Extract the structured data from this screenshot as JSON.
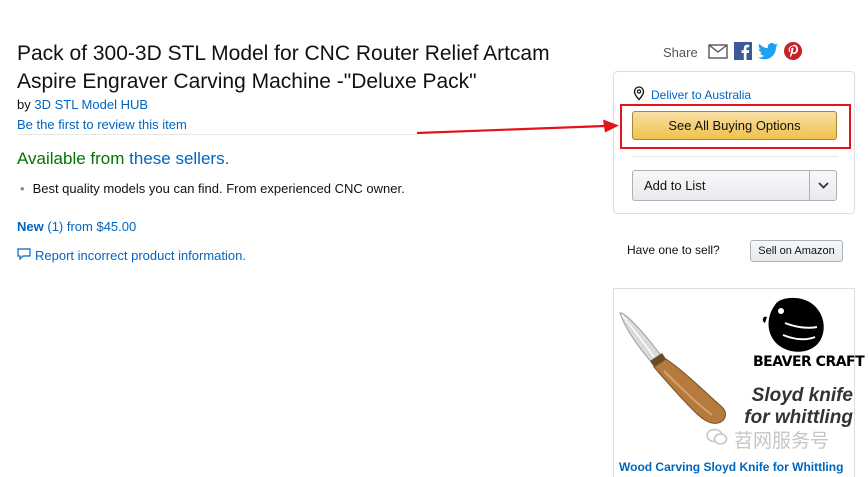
{
  "product": {
    "title": "Pack of 300-3D STL Model for CNC Router Relief Artcam Aspire Engraver Carving Machine -\"Deluxe Pack\"",
    "by_prefix": "by",
    "brand": "3D STL Model HUB",
    "review_link": "Be the first to review this item",
    "available_prefix": "Available from",
    "available_link": "these sellers.",
    "bullets": [
      "Best quality models you can find. From experienced CNC owner."
    ],
    "new_label": "New",
    "new_count": "(1) from $45.00",
    "report_link": "Report incorrect product information."
  },
  "share": {
    "label": "Share",
    "icons": [
      "email-icon",
      "facebook-icon",
      "twitter-icon",
      "pinterest-icon"
    ]
  },
  "buybox": {
    "deliver_link": "Deliver to Australia",
    "buying_options_button": "See All Buying Options",
    "add_to_list": "Add to List"
  },
  "sell": {
    "question": "Have one to sell?",
    "button": "Sell on Amazon"
  },
  "ad": {
    "brand": "BEAVER CRAFT",
    "headline_line1": "Sloyd knife",
    "headline_line2": "for whittling",
    "caption": "Wood Carving Sloyd Knife for Whittling"
  },
  "watermark": {
    "text": "苕网服务号"
  },
  "colors": {
    "link": "#0066c0",
    "available": "#007600",
    "highlight": "#e4141b",
    "button_yellow": "#f0c14b"
  }
}
